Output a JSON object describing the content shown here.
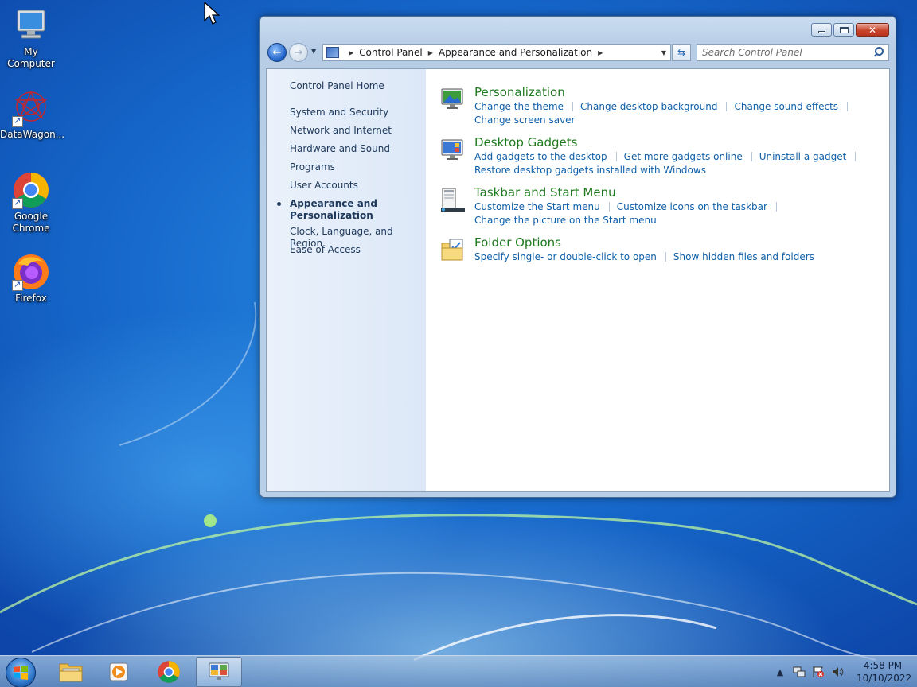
{
  "desktop": {
    "icons": [
      {
        "label": "My Computer",
        "icon": "computer-icon"
      },
      {
        "label": "DataWagon...",
        "icon": "datawagon-icon"
      },
      {
        "label": "Google Chrome",
        "icon": "chrome-icon"
      },
      {
        "label": "Firefox",
        "icon": "firefox-icon"
      }
    ]
  },
  "window": {
    "breadcrumb": [
      "Control Panel",
      "Appearance and Personalization"
    ],
    "search_placeholder": "Search Control Panel",
    "left_pane": {
      "home": "Control Panel Home",
      "items": [
        "System and Security",
        "Network and Internet",
        "Hardware and Sound",
        "Programs",
        "User Accounts",
        "Appearance and Personalization",
        "Clock, Language, and Region",
        "Ease of Access"
      ],
      "current_index": 5
    },
    "categories": [
      {
        "title": "Personalization",
        "icon": "personalization-icon",
        "links": [
          "Change the theme",
          "Change desktop background",
          "Change sound effects",
          "Change screen saver"
        ]
      },
      {
        "title": "Desktop Gadgets",
        "icon": "gadgets-icon",
        "links": [
          "Add gadgets to the desktop",
          "Get more gadgets online",
          "Uninstall a gadget",
          "Restore desktop gadgets installed with Windows"
        ]
      },
      {
        "title": "Taskbar and Start Menu",
        "icon": "taskbar-icon",
        "links": [
          "Customize the Start menu",
          "Customize icons on the taskbar",
          "Change the picture on the Start menu"
        ]
      },
      {
        "title": "Folder Options",
        "icon": "folder-options-icon",
        "links": [
          "Specify single- or double-click to open",
          "Show hidden files and folders"
        ]
      }
    ]
  },
  "taskbar": {
    "clock_time": "4:58 PM",
    "clock_date": "10/10/2022"
  },
  "colors": {
    "link": "#0f5fa8",
    "category_title": "#1e7a1e",
    "left_pane_text": "#1e395b"
  }
}
